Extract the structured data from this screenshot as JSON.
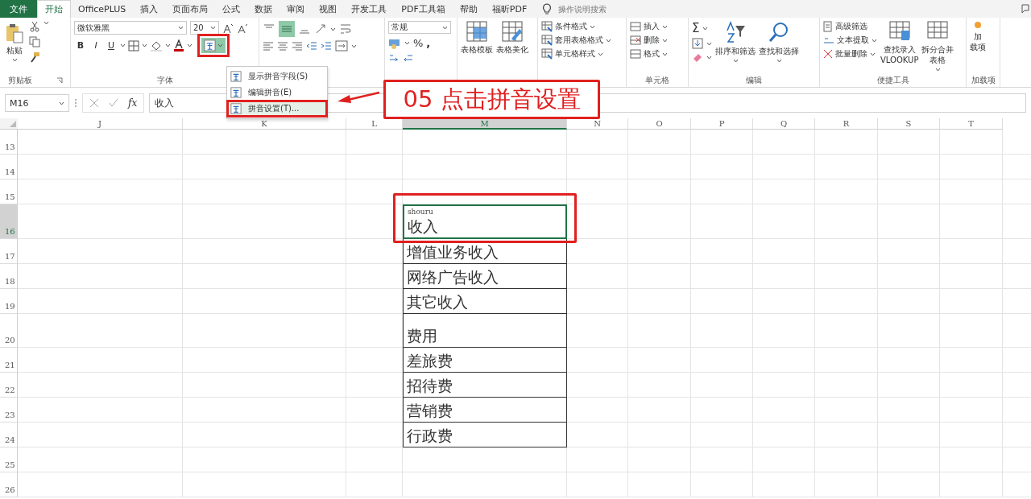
{
  "menu_tabs": [
    {
      "label": "文件",
      "kind": "file",
      "selected": false
    },
    {
      "label": "开始",
      "kind": "tab",
      "selected": true
    },
    {
      "label": "OfficePLUS",
      "kind": "tab",
      "selected": false
    },
    {
      "label": "插入",
      "kind": "tab",
      "selected": false
    },
    {
      "label": "页面布局",
      "kind": "tab",
      "selected": false
    },
    {
      "label": "公式",
      "kind": "tab",
      "selected": false
    },
    {
      "label": "数据",
      "kind": "tab",
      "selected": false
    },
    {
      "label": "审阅",
      "kind": "tab",
      "selected": false
    },
    {
      "label": "视图",
      "kind": "tab",
      "selected": false
    },
    {
      "label": "开发工具",
      "kind": "tab",
      "selected": false
    },
    {
      "label": "PDF工具箱",
      "kind": "tab",
      "selected": false
    },
    {
      "label": "帮助",
      "kind": "tab",
      "selected": false
    },
    {
      "label": "福昕PDF",
      "kind": "tab",
      "selected": false
    }
  ],
  "tell_me": {
    "placeholder": "操作说明搜索"
  },
  "ribbon": {
    "clipboard": {
      "paste": "粘贴",
      "label": "剪贴板"
    },
    "font": {
      "font_name": "微软雅黑",
      "font_size": "20",
      "bold": "B",
      "italic": "I",
      "underline": "U",
      "label": "字体"
    },
    "pinyin_button": {
      "on": true
    },
    "number": {
      "format": "常规",
      "percent": "%",
      "comma": ","
    },
    "officeplus": {
      "buttons": [
        "表格模板",
        "表格美化"
      ]
    },
    "styles": {
      "buttons": [
        "条件格式",
        "套用表格格式",
        "单元格样式"
      ]
    },
    "cells": {
      "buttons": [
        "插入",
        "删除",
        "格式"
      ],
      "label": "单元格"
    },
    "editing": {
      "sum": "Σ",
      "buttons": [
        "排序和筛选",
        "查找和选择"
      ],
      "label": "编辑"
    },
    "tools": {
      "small": [
        "高级筛选",
        "文本提取",
        "批量删除"
      ],
      "large": [
        [
          "查找录入",
          "VLOOKUP"
        ],
        [
          "拆分合并",
          "表格"
        ]
      ],
      "label": "便捷工具"
    },
    "addins": {
      "button": [
        "加",
        "载项"
      ],
      "label": "加载项"
    }
  },
  "pinyin_menu": [
    {
      "label": "显示拼音字段(S)",
      "selected": false
    },
    {
      "label": "编辑拼音(E)",
      "selected": false
    },
    {
      "label": "拼音设置(T)...",
      "selected": true
    }
  ],
  "formula_bar": {
    "name_box": "M16",
    "fx": "fx",
    "value": "收入"
  },
  "sheet": {
    "columns": [
      {
        "label": "J",
        "selected": false
      },
      {
        "label": "K",
        "selected": false
      },
      {
        "label": "L",
        "selected": false
      },
      {
        "label": "M",
        "selected": true
      },
      {
        "label": "N",
        "selected": false
      },
      {
        "label": "O",
        "selected": false
      },
      {
        "label": "P",
        "selected": false
      },
      {
        "label": "Q",
        "selected": false
      },
      {
        "label": "R",
        "selected": false
      },
      {
        "label": "S",
        "selected": false
      },
      {
        "label": "T",
        "selected": false
      }
    ],
    "rows": [
      {
        "label": "13",
        "selected": false
      },
      {
        "label": "14",
        "selected": false
      },
      {
        "label": "15",
        "selected": false
      },
      {
        "label": "16",
        "selected": true,
        "cell": {
          "text": "收入",
          "phonetic": "shouru",
          "selected": true
        }
      },
      {
        "label": "17",
        "selected": false,
        "cell": {
          "text": "增值业务收入",
          "selected": false
        }
      },
      {
        "label": "18",
        "selected": false,
        "cell": {
          "text": "网络广告收入",
          "selected": false
        }
      },
      {
        "label": "19",
        "selected": false,
        "cell": {
          "text": "其它收入",
          "selected": false
        }
      },
      {
        "label": "20",
        "selected": false,
        "cell": {
          "text": "费用",
          "selected": false
        }
      },
      {
        "label": "21",
        "selected": false,
        "cell": {
          "text": "差旅费",
          "selected": false
        }
      },
      {
        "label": "22",
        "selected": false,
        "cell": {
          "text": "招待费",
          "selected": false
        }
      },
      {
        "label": "23",
        "selected": false,
        "cell": {
          "text": "营销费",
          "selected": false
        }
      },
      {
        "label": "24",
        "selected": false,
        "cell": {
          "text": "行政费",
          "selected": false
        }
      },
      {
        "label": "25",
        "selected": false
      },
      {
        "label": "26",
        "selected": false
      }
    ]
  },
  "annotation": {
    "text": "05 点击拼音设置"
  }
}
